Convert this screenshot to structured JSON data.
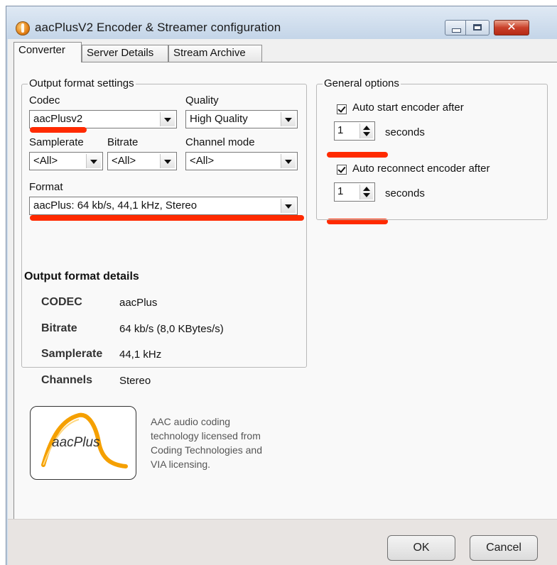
{
  "window": {
    "title": "aacPlusV2 Encoder & Streamer configuration"
  },
  "tabs": [
    "Converter",
    "Server Details",
    "Stream Archive"
  ],
  "output_format": {
    "legend": "Output format settings",
    "codec": {
      "label": "Codec",
      "value": "aacPlusv2"
    },
    "quality": {
      "label": "Quality",
      "value": "High Quality"
    },
    "samplerate": {
      "label": "Samplerate",
      "value": "<All>"
    },
    "bitrate": {
      "label": "Bitrate",
      "value": "<All>"
    },
    "channel_mode": {
      "label": "Channel mode",
      "value": "<All>"
    },
    "format": {
      "label": "Format",
      "value": "aacPlus: 64 kb/s, 44,1 kHz, Stereo"
    },
    "details_title": "Output format details",
    "details": [
      {
        "key": "CODEC",
        "value": "aacPlus"
      },
      {
        "key": "Bitrate",
        "value": "64 kb/s (8,0 KBytes/s)"
      },
      {
        "key": "Samplerate",
        "value": "44,1 kHz"
      },
      {
        "key": "Channels",
        "value": "Stereo"
      }
    ]
  },
  "general": {
    "legend": "General options",
    "auto_start": {
      "label": "Auto start encoder after",
      "checked": true,
      "value": "1",
      "unit": "seconds"
    },
    "auto_reconnect": {
      "label": "Auto reconnect encoder after",
      "checked": true,
      "value": "1",
      "unit": "seconds"
    }
  },
  "logo": {
    "text": "aacPlus",
    "note": "AAC audio coding\ntechnology licensed from\nCoding Technologies and\nVIA licensing."
  },
  "buttons": {
    "ok": "OK",
    "cancel": "Cancel"
  },
  "colors": {
    "annotation": "#ff2a00",
    "logo_arc": "#f5a000"
  }
}
